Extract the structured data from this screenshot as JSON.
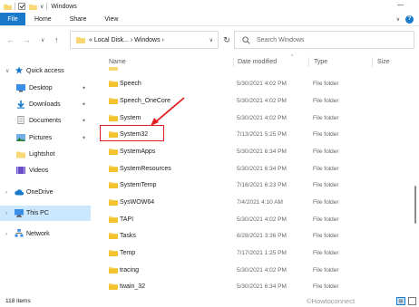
{
  "window": {
    "title": "Windows",
    "quick_access_dropdown": "∨",
    "minimize": "—",
    "expand": "∨",
    "help": "?"
  },
  "ribbon": {
    "tabs": [
      "File",
      "Home",
      "Share",
      "View"
    ]
  },
  "nav_buttons": {
    "back": "←",
    "forward": "→",
    "recent": "∨",
    "up": "↑",
    "refresh": "↻"
  },
  "address": {
    "path": "« Local Disk... › Windows ›",
    "chevron": "∨"
  },
  "search": {
    "placeholder": "Search Windows"
  },
  "nav_pane": {
    "items": [
      {
        "label": "Quick access",
        "icon": "star-icon",
        "pinned": false
      },
      {
        "label": "Desktop",
        "icon": "desktop-icon",
        "pinned": true
      },
      {
        "label": "Downloads",
        "icon": "download-icon",
        "pinned": true
      },
      {
        "label": "Documents",
        "icon": "document-icon",
        "pinned": true
      },
      {
        "label": "Pictures",
        "icon": "pictures-icon",
        "pinned": true
      },
      {
        "label": "Lightshot",
        "icon": "folder-icon",
        "pinned": false
      },
      {
        "label": "Videos",
        "icon": "videos-icon",
        "pinned": false
      },
      {
        "label": "OneDrive",
        "icon": "cloud-icon",
        "pinned": false
      },
      {
        "label": "This PC",
        "icon": "computer-icon",
        "pinned": false,
        "selected": true
      },
      {
        "label": "Network",
        "icon": "network-icon",
        "pinned": false
      }
    ]
  },
  "columns": {
    "name": "Name",
    "date": "Date modified",
    "type": "Type",
    "size": "Size",
    "sort_caret": "^"
  },
  "files": [
    {
      "name": "Speech",
      "date": "5/30/2021 4:02 PM",
      "type": "File folder"
    },
    {
      "name": "Speech_OneCore",
      "date": "5/30/2021 4:02 PM",
      "type": "File folder"
    },
    {
      "name": "System",
      "date": "5/30/2021 4:02 PM",
      "type": "File folder"
    },
    {
      "name": "System32",
      "date": "7/13/2021 5:25 PM",
      "type": "File folder",
      "highlighted": true
    },
    {
      "name": "SystemApps",
      "date": "5/30/2021 6:34 PM",
      "type": "File folder"
    },
    {
      "name": "SystemResources",
      "date": "5/30/2021 6:34 PM",
      "type": "File folder"
    },
    {
      "name": "SystemTemp",
      "date": "7/16/2021 6:23 PM",
      "type": "File folder"
    },
    {
      "name": "SysWOW64",
      "date": "7/4/2021 4:10 AM",
      "type": "File folder"
    },
    {
      "name": "TAPI",
      "date": "5/30/2021 4:02 PM",
      "type": "File folder"
    },
    {
      "name": "Tasks",
      "date": "6/28/2021 3:36 PM",
      "type": "File folder"
    },
    {
      "name": "Temp",
      "date": "7/17/2021 1:25 PM",
      "type": "File folder"
    },
    {
      "name": "tracing",
      "date": "5/30/2021 4:02 PM",
      "type": "File folder"
    },
    {
      "name": "twain_32",
      "date": "5/30/2021 6:34 PM",
      "type": "File folder"
    }
  ],
  "status": {
    "items_count": "118 items",
    "watermark": "©Howtoconnect"
  },
  "colors": {
    "accent": "#1979ca",
    "selection": "#cce8ff",
    "annotation": "#e02020",
    "folder": "#f8d775"
  }
}
